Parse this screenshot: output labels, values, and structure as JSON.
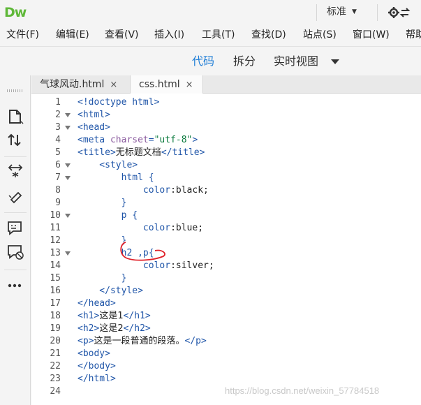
{
  "app": {
    "logo": "Dw"
  },
  "workspace": {
    "label": "标准"
  },
  "icons": {
    "sync": "sync-settings-icon"
  },
  "menu": [
    "文件(F)",
    "编辑(E)",
    "查看(V)",
    "插入(I)",
    "工具(T)",
    "查找(D)",
    "站点(S)",
    "窗口(W)",
    "帮助"
  ],
  "views": {
    "code": "代码",
    "split": "拆分",
    "live": "实时视图"
  },
  "tabs": [
    {
      "label": "气球风动.html",
      "close": "×"
    },
    {
      "label": "css.html",
      "close": "×"
    }
  ],
  "colors": {
    "accent": "#1e7dd6",
    "logo": "#5fb839",
    "annotation": "#e0222a"
  },
  "code_lines": [
    {
      "num": "1",
      "fold": false,
      "tokens": [
        {
          "t": "<!doctype html>",
          "c": "t-tag"
        }
      ]
    },
    {
      "num": "2",
      "fold": true,
      "tokens": [
        {
          "t": "<html>",
          "c": "t-tag"
        }
      ]
    },
    {
      "num": "3",
      "fold": true,
      "tokens": [
        {
          "t": "<head>",
          "c": "t-tag"
        }
      ]
    },
    {
      "num": "4",
      "fold": false,
      "tokens": [
        {
          "t": "<meta ",
          "c": "t-tag"
        },
        {
          "t": "charset",
          "c": "t-attr"
        },
        {
          "t": "=",
          "c": "t-tag"
        },
        {
          "t": "\"utf-8\"",
          "c": "t-str"
        },
        {
          "t": ">",
          "c": "t-tag"
        }
      ]
    },
    {
      "num": "5",
      "fold": false,
      "tokens": [
        {
          "t": "<title>",
          "c": "t-tag"
        },
        {
          "t": "无标题文档",
          "c": "t-txt"
        },
        {
          "t": "</title>",
          "c": "t-tag"
        }
      ]
    },
    {
      "num": "6",
      "fold": true,
      "tokens": [
        {
          "t": "    <style>",
          "c": "t-tag"
        }
      ]
    },
    {
      "num": "7",
      "fold": true,
      "tokens": [
        {
          "t": "        html {",
          "c": "t-sel"
        }
      ]
    },
    {
      "num": "8",
      "fold": false,
      "tokens": [
        {
          "t": "            color",
          "c": "t-prop"
        },
        {
          "t": ":black;",
          "c": ""
        }
      ]
    },
    {
      "num": "9",
      "fold": false,
      "tokens": [
        {
          "t": "        }",
          "c": "t-sel"
        }
      ]
    },
    {
      "num": "10",
      "fold": true,
      "tokens": [
        {
          "t": "        p {",
          "c": "t-sel"
        }
      ]
    },
    {
      "num": "11",
      "fold": false,
      "tokens": [
        {
          "t": "            color",
          "c": "t-prop"
        },
        {
          "t": ":blue;",
          "c": ""
        }
      ]
    },
    {
      "num": "12",
      "fold": false,
      "tokens": [
        {
          "t": "        }",
          "c": "t-sel"
        }
      ]
    },
    {
      "num": "13",
      "fold": true,
      "tokens": [
        {
          "t": "        h2 ,p{",
          "c": "t-sel"
        }
      ]
    },
    {
      "num": "14",
      "fold": false,
      "tokens": [
        {
          "t": "            color",
          "c": "t-prop"
        },
        {
          "t": ":silver;",
          "c": ""
        }
      ]
    },
    {
      "num": "15",
      "fold": false,
      "tokens": [
        {
          "t": "        }",
          "c": "t-sel"
        }
      ]
    },
    {
      "num": "16",
      "fold": false,
      "tokens": [
        {
          "t": "    </style>",
          "c": "t-tag"
        }
      ]
    },
    {
      "num": "17",
      "fold": false,
      "tokens": [
        {
          "t": "</head>",
          "c": "t-tag"
        }
      ]
    },
    {
      "num": "18",
      "fold": false,
      "tokens": [
        {
          "t": "<h1>",
          "c": "t-tag"
        },
        {
          "t": "这是1",
          "c": "t-txt"
        },
        {
          "t": "</h1>",
          "c": "t-tag"
        }
      ]
    },
    {
      "num": "19",
      "fold": false,
      "tokens": [
        {
          "t": "<h2>",
          "c": "t-tag"
        },
        {
          "t": "这是2",
          "c": "t-txt"
        },
        {
          "t": "</h2>",
          "c": "t-tag"
        }
      ]
    },
    {
      "num": "20",
      "fold": false,
      "tokens": [
        {
          "t": "<p>",
          "c": "t-tag"
        },
        {
          "t": "这是一段普通的段落。",
          "c": "t-txt"
        },
        {
          "t": "</p>",
          "c": "t-tag"
        }
      ]
    },
    {
      "num": "21",
      "fold": false,
      "tokens": [
        {
          "t": "<body>",
          "c": "t-tag"
        }
      ]
    },
    {
      "num": "22",
      "fold": false,
      "tokens": [
        {
          "t": "</body>",
          "c": "t-tag"
        }
      ]
    },
    {
      "num": "23",
      "fold": false,
      "tokens": [
        {
          "t": "</html>",
          "c": "t-tag"
        }
      ]
    },
    {
      "num": "24",
      "fold": false,
      "tokens": []
    }
  ],
  "watermark": "https://blog.csdn.net/weixin_57784518"
}
